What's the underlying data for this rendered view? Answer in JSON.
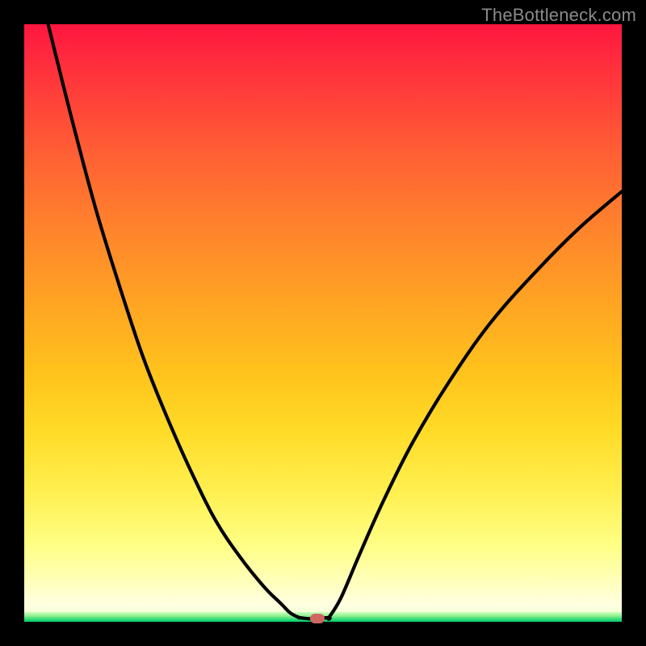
{
  "watermark": "TheBottleneck.com",
  "colors": {
    "background": "#000000",
    "gradient_top": "#ff163f",
    "gradient_mid": "#ffc21c",
    "gradient_low": "#ffffb8",
    "gradient_bottom": "#00cf6c",
    "curve": "#000000",
    "marker": "#cf6760"
  },
  "chart_data": {
    "type": "line",
    "title": "",
    "xlabel": "",
    "ylabel": "",
    "xlim": [
      0,
      100
    ],
    "ylim": [
      0,
      100
    ],
    "grid": false,
    "series": [
      {
        "name": "left-branch",
        "x": [
          4,
          8,
          12,
          16,
          20,
          24,
          28,
          32,
          36,
          40,
          43,
          44.5,
          46
        ],
        "values": [
          100,
          84,
          69,
          56,
          44,
          34,
          25,
          17,
          11,
          6,
          3,
          1.5,
          0.7
        ]
      },
      {
        "name": "right-branch",
        "x": [
          51,
          53,
          56,
          60,
          65,
          71,
          78,
          86,
          93,
          100
        ],
        "values": [
          0.7,
          4,
          11,
          20,
          30,
          40,
          50,
          59,
          66,
          72
        ]
      },
      {
        "name": "flat-bottom",
        "x": [
          46,
          48,
          51
        ],
        "values": [
          0.7,
          0.5,
          0.7
        ]
      }
    ],
    "marker": {
      "x": 49,
      "y": 0.5,
      "color": "#cf6760"
    }
  }
}
